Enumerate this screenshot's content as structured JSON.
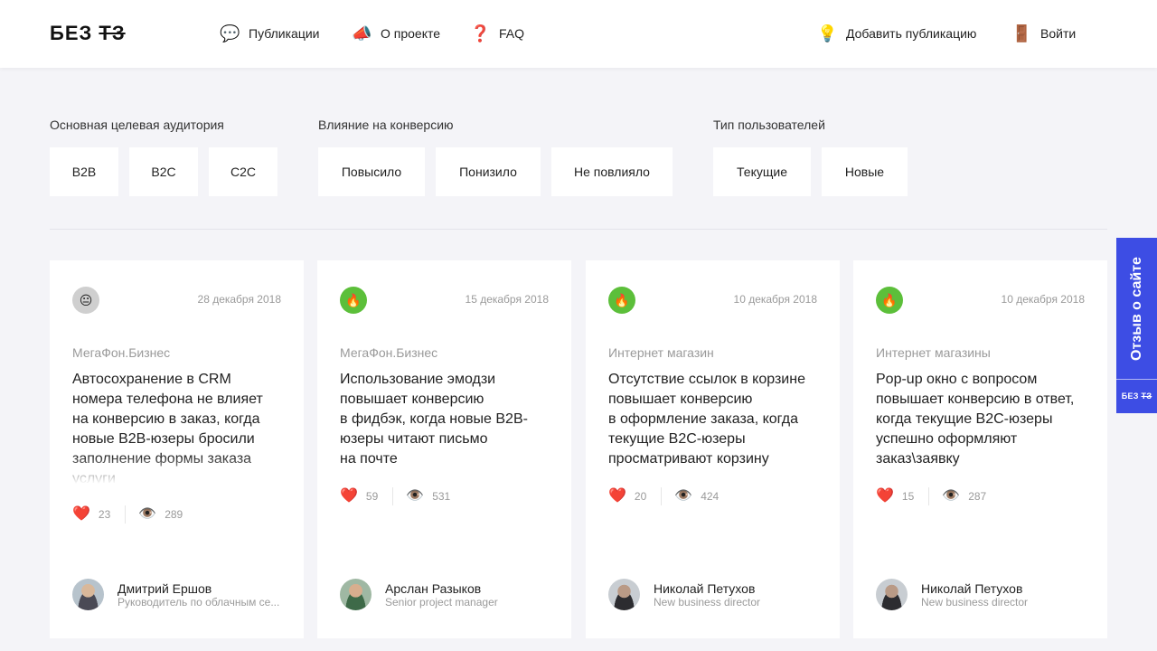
{
  "header": {
    "logo_part1": "БЕЗ",
    "logo_part2": "ТЗ",
    "nav": [
      {
        "icon": "💬",
        "label": "Публикации"
      },
      {
        "icon": "📣",
        "label": "О проекте"
      },
      {
        "icon": "❓",
        "label": "FAQ"
      }
    ],
    "add_publication": {
      "icon": "💡",
      "label": "Добавить публикацию"
    },
    "login": {
      "icon": "🚪",
      "label": "Войти"
    }
  },
  "filters": [
    {
      "title": "Основная целевая аудитория",
      "options": [
        "B2B",
        "B2C",
        "C2C"
      ]
    },
    {
      "title": "Влияние на конверсию",
      "options": [
        "Повысило",
        "Понизило",
        "Не повлияло"
      ]
    },
    {
      "title": "Тип пользователей",
      "options": [
        "Текущие",
        "Новые"
      ]
    }
  ],
  "cards": [
    {
      "emoji": "😐",
      "date": "28 декабря 2018",
      "category": "МегаФон.Бизнес",
      "title": "Автосохранение в CRM\nномера телефона не влияет\nна конверсию в заказ, когда\nновые B2B-юзеры бросили\nзаполнение формы заказа\nуслуги",
      "likes": "23",
      "views": "289",
      "author_name": "Дмитрий Ершов",
      "author_role": "Руководитель по облачным се..."
    },
    {
      "emoji": "🔥",
      "date": "15 декабря 2018",
      "category": "МегаФон.Бизнес",
      "title": "Использование эмодзи\nповышает конверсию\nв фидбэк, когда новые B2B-\nюзеры читают письмо\nна почте",
      "likes": "59",
      "views": "531",
      "author_name": "Арслан Разыков",
      "author_role": "Senior project manager"
    },
    {
      "emoji": "🔥",
      "date": "10 декабря 2018",
      "category": "Интернет магазин",
      "title": "Отсутствие ссылок в корзине\nповышает конверсию\nв оформление заказа, когда\nтекущие B2C-юзеры\nпросматривают корзину",
      "likes": "20",
      "views": "424",
      "author_name": "Николай Петухов",
      "author_role": "New business director"
    },
    {
      "emoji": "🔥",
      "date": "10 декабря 2018",
      "category": "Интернет магазины",
      "title": "Pop-up окно с вопросом\nповышает конверсию в ответ,\nкогда текущие B2C-юзеры\nуспешно оформляют\nзаказ\\заявку",
      "likes": "15",
      "views": "287",
      "author_name": "Николай Петухов",
      "author_role": "New business director"
    }
  ],
  "stat_icons": {
    "like": "❤️",
    "view": "👁️"
  },
  "feedback_tab": {
    "label": "Отзыв о сайте",
    "logo_part1": "БЕЗ",
    "logo_part2": "ТЗ"
  },
  "colors": {
    "background": "#f4f4f8",
    "accent": "#3d4de4",
    "badge_fire": "#5cbf3a",
    "badge_neutral": "#cfcfcf"
  }
}
